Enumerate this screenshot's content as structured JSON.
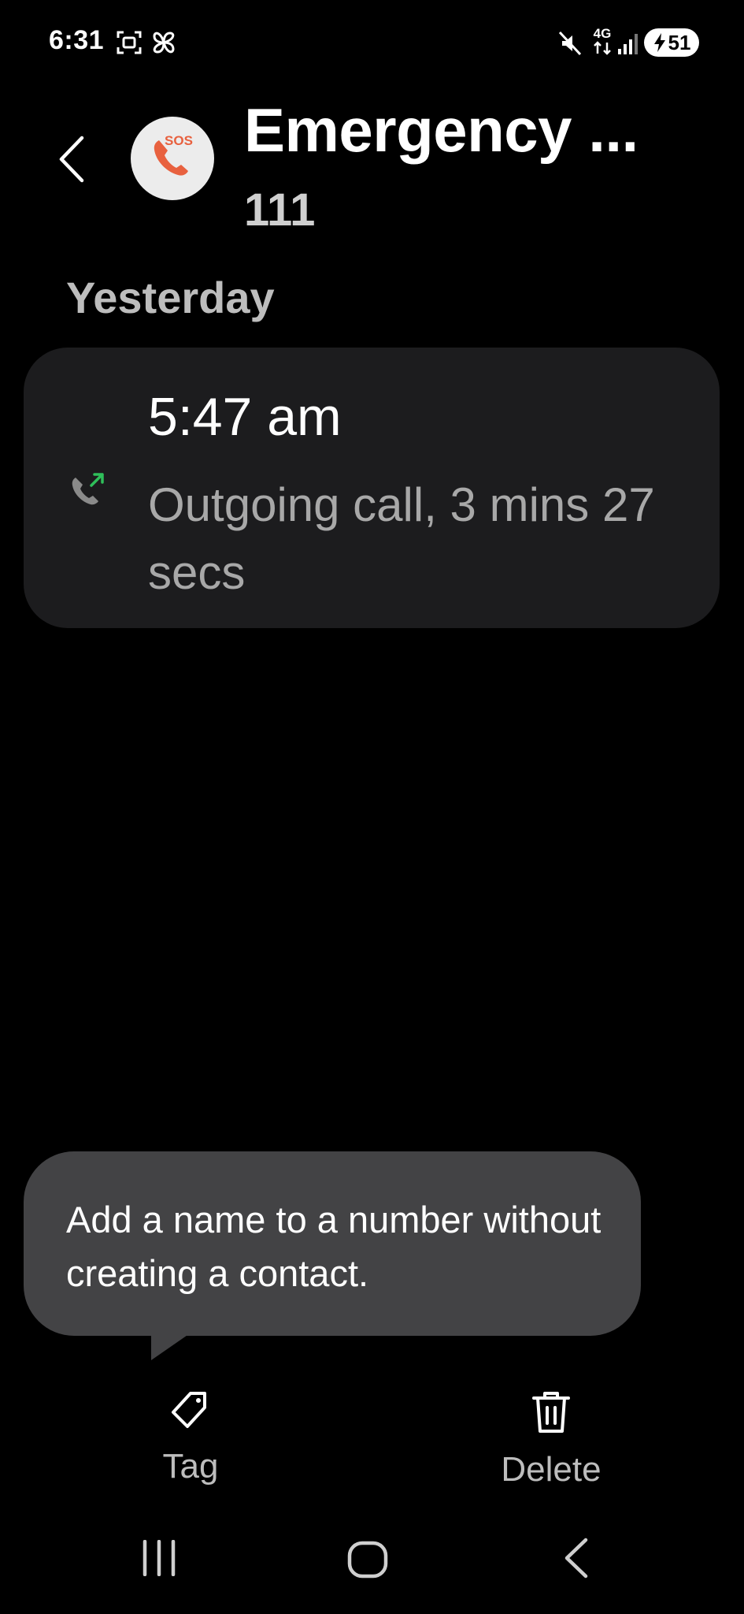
{
  "status_bar": {
    "time": "6:31",
    "left_icons": [
      "screenshot-icon",
      "pinwheel-icon"
    ],
    "right_icons": [
      "mute-icon",
      "4g-data-icon",
      "signal-icon"
    ],
    "network": "4G",
    "battery": "51"
  },
  "header": {
    "back_icon": "back-arrow-icon",
    "avatar_icon": "sos-phone-icon",
    "avatar_text": "SOS",
    "name": "Emergency ...",
    "number": "111"
  },
  "log": {
    "section": "Yesterday",
    "entries": [
      {
        "time": "5:47 am",
        "detail": "Outgoing call, 3 mins 27 secs",
        "icon": "outgoing-call-icon"
      }
    ]
  },
  "tooltip": {
    "text": "Add a name to a number without creating a contact."
  },
  "actions": {
    "tag": {
      "label": "Tag",
      "icon": "tag-icon"
    },
    "delete": {
      "label": "Delete",
      "icon": "trash-icon"
    }
  },
  "nav": [
    "recents-icon",
    "home-icon",
    "back-icon"
  ],
  "colors": {
    "background": "#000000",
    "card": "#1c1c1e",
    "tooltip": "#434345",
    "sos_red": "#e8613f",
    "outgoing_arrow": "#2fbf5a"
  }
}
